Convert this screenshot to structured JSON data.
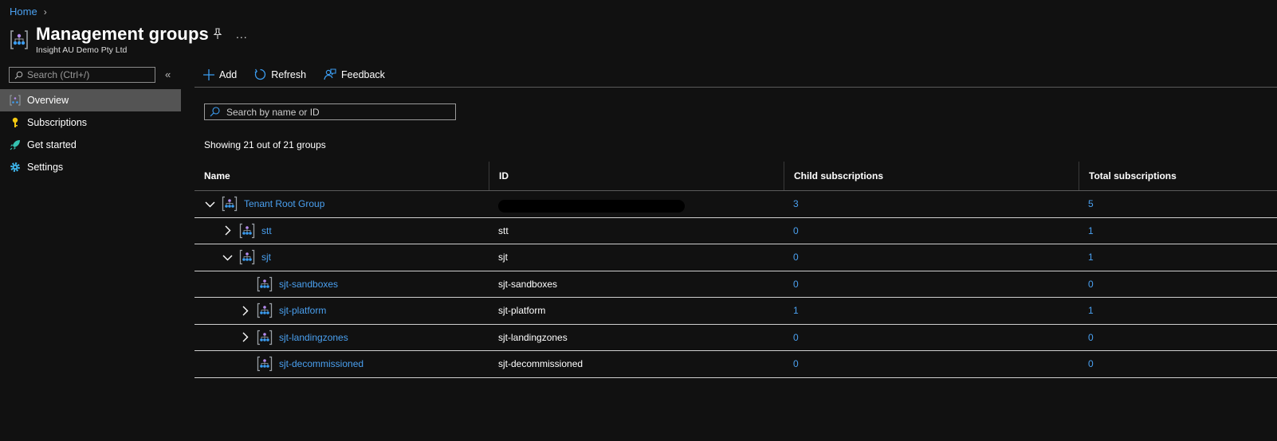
{
  "breadcrumb": {
    "home": "Home"
  },
  "header": {
    "title": "Management groups",
    "subtitle": "Insight AU Demo Pty Ltd",
    "more": "..."
  },
  "sidebar": {
    "search_placeholder": "Search (Ctrl+/)",
    "collapse": "«",
    "items": [
      {
        "label": "Overview",
        "icon": "management-group-icon",
        "active": true
      },
      {
        "label": "Subscriptions",
        "icon": "key-icon",
        "active": false
      },
      {
        "label": "Get started",
        "icon": "rocket-icon",
        "active": false
      },
      {
        "label": "Settings",
        "icon": "gear-icon",
        "active": false
      }
    ]
  },
  "toolbar": {
    "add": "Add",
    "refresh": "Refresh",
    "feedback": "Feedback"
  },
  "main": {
    "search_placeholder": "Search by name or ID",
    "showing": "Showing 21 out of 21 groups"
  },
  "table": {
    "columns": [
      "Name",
      "ID",
      "Child subscriptions",
      "Total subscriptions"
    ],
    "rows": [
      {
        "name": "Tenant Root Group",
        "id": "",
        "child": "3",
        "total": "5",
        "level": 0,
        "expander": "expanded"
      },
      {
        "name": "stt",
        "id": "stt",
        "child": "0",
        "total": "1",
        "level": 1,
        "expander": "collapsed"
      },
      {
        "name": "sjt",
        "id": "sjt",
        "child": "0",
        "total": "1",
        "level": 1,
        "expander": "expanded"
      },
      {
        "name": "sjt-sandboxes",
        "id": "sjt-sandboxes",
        "child": "0",
        "total": "0",
        "level": 2,
        "expander": "none"
      },
      {
        "name": "sjt-platform",
        "id": "sjt-platform",
        "child": "1",
        "total": "1",
        "level": 2,
        "expander": "collapsed"
      },
      {
        "name": "sjt-landingzones",
        "id": "sjt-landingzones",
        "child": "0",
        "total": "0",
        "level": 2,
        "expander": "collapsed"
      },
      {
        "name": "sjt-decommissioned",
        "id": "sjt-decommissioned",
        "child": "0",
        "total": "0",
        "level": 2,
        "expander": "none"
      }
    ]
  },
  "colors": {
    "background": "#111111",
    "link": "#4aa0f0",
    "active_nav": "#545454",
    "accent_blue": "#3b9cf0"
  }
}
